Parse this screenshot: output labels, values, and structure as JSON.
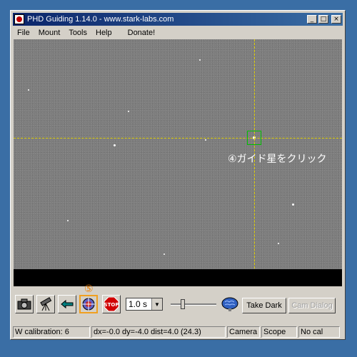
{
  "window": {
    "title": "PHD Guiding 1.14.0  -  www.stark-labs.com"
  },
  "menu": [
    "File",
    "Mount",
    "Tools",
    "Help",
    "Donate!"
  ],
  "viewport": {
    "annotation_step4": "④ガイド星をクリック",
    "guide_line_color": "#e0d000",
    "selection_color": "#00c000"
  },
  "toolbar": {
    "annotation_step5": "⑤",
    "icons": [
      "camera-icon",
      "telescope-icon",
      "loop-icon",
      "guide-icon",
      "stop-icon",
      "brain-icon"
    ],
    "exposure_value": "1.0 s",
    "take_dark_label": "Take Dark",
    "cam_dialog_label": "Cam Dialog"
  },
  "status": {
    "calibration": "W calibration: 6",
    "offsets": "dx=-0.0 dy=-4.0 dist=4.0 (24.3)",
    "camera": "Camera",
    "scope": "Scope",
    "cal": "No cal"
  },
  "colors": {
    "accent_highlight": "#f0a020",
    "annotation_orange": "#f08000",
    "title_bar": "#0a246a",
    "desktop": "#3a6ea5"
  }
}
